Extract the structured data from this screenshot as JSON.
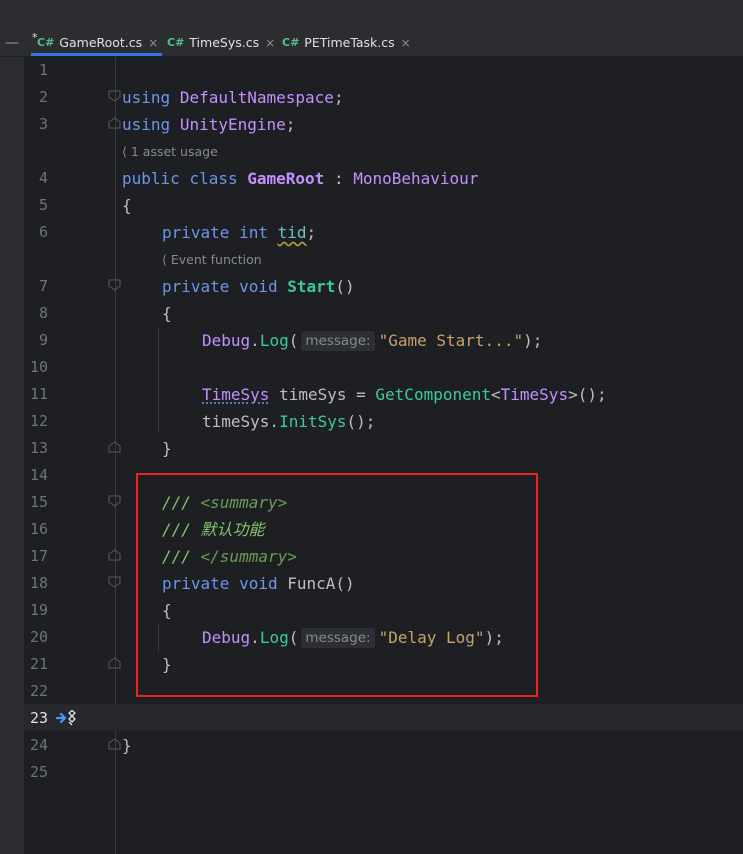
{
  "tabs": [
    {
      "modified_mark": "*",
      "lang": "C#",
      "label": "GameRoot.cs",
      "active": true
    },
    {
      "lang": "C#",
      "label": "TimeSys.cs",
      "active": false
    },
    {
      "lang": "C#",
      "label": "PETimeTask.cs",
      "active": false
    }
  ],
  "tab_close_glyph": "×",
  "collapse_glyph": "—",
  "hints": {
    "asset_usage": "1 asset usage",
    "event_function": "Event function"
  },
  "line_numbers": [
    "1",
    "2",
    "3",
    "4",
    "5",
    "6",
    "7",
    "8",
    "9",
    "10",
    "11",
    "12",
    "13",
    "14",
    "15",
    "16",
    "17",
    "18",
    "19",
    "20",
    "21",
    "22",
    "23",
    "24",
    "25"
  ],
  "current_line": "23",
  "code": {
    "l2": {
      "kw": "using",
      "ns": "DefaultNamespace",
      "end": ";"
    },
    "l3": {
      "kw": "using",
      "ns": "UnityEngine",
      "end": ";"
    },
    "l4": {
      "kw1": "public",
      "kw2": "class",
      "name": "GameRoot",
      "colon": " : ",
      "base": "MonoBehaviour"
    },
    "l5": "{",
    "l6": {
      "kw1": "private",
      "kw2": "int",
      "field": "tid",
      "end": ";"
    },
    "l7": {
      "kw1": "private",
      "kw2": "void",
      "name": "Start",
      "parens": "()"
    },
    "l8": "{",
    "l9": {
      "cls": "Debug",
      "dot": ".",
      "method": "Log",
      "open": "(",
      "param_hint": "message:",
      "str": "\"Game Start...\"",
      "close": ");"
    },
    "l11": {
      "type": "TimeSys",
      "var": " timeSys = ",
      "method": "GetComponent",
      "lt": "<",
      "targ": "TimeSys",
      "gt": ">",
      "close": "();"
    },
    "l12": {
      "var": "timeSys.",
      "method": "InitSys",
      "close": "();"
    },
    "l13": "}",
    "l15": {
      "slashes": "/// ",
      "tag": "<summary>"
    },
    "l16": {
      "slashes": "/// ",
      "text": "默认功能"
    },
    "l17": {
      "slashes": "/// ",
      "tag": "</summary>"
    },
    "l18": {
      "kw1": "private",
      "kw2": "void",
      "name": "FuncA",
      "parens": "()"
    },
    "l19": "{",
    "l20": {
      "cls": "Debug",
      "dot": ".",
      "method": "Log",
      "open": "(",
      "param_hint": "message:",
      "str": "\"Delay Log\"",
      "close": ");"
    },
    "l21": "}",
    "l24": "}"
  },
  "colors": {
    "background": "#1e1f22",
    "keyword": "#6c95eb",
    "type": "#c191ff",
    "method": "#39cc9b",
    "string": "#c9a26d",
    "comment": "#85c46c",
    "highlight_box": "#e8251f"
  }
}
